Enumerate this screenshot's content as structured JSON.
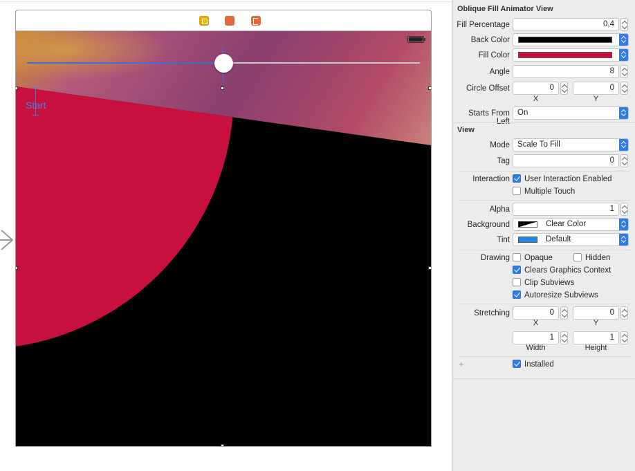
{
  "scene": {
    "slider_value": 0.5,
    "start_label": "Start",
    "fill_color": "#c8103f",
    "back_color": "#000000"
  },
  "inspector": {
    "section1_title": "Oblique Fill Animator View",
    "fill_percentage": {
      "label": "Fill Percentage",
      "value": "0,4"
    },
    "back_color": {
      "label": "Back Color",
      "color": "#000000"
    },
    "fill_color": {
      "label": "Fill Color",
      "color": "#c8103f"
    },
    "angle": {
      "label": "Angle",
      "value": "8"
    },
    "circle_offset": {
      "label": "Circle Offset",
      "x": "0",
      "y": "0",
      "x_label": "X",
      "y_label": "Y"
    },
    "starts_from_left": {
      "label": "Starts From Left",
      "value": "On"
    },
    "section2_title": "View",
    "mode": {
      "label": "Mode",
      "value": "Scale To Fill"
    },
    "tag": {
      "label": "Tag",
      "value": "0"
    },
    "interaction": {
      "label": "Interaction",
      "user_interaction": {
        "label": "User Interaction Enabled",
        "checked": true
      },
      "multiple_touch": {
        "label": "Multiple Touch",
        "checked": false
      }
    },
    "alpha": {
      "label": "Alpha",
      "value": "1"
    },
    "background": {
      "label": "Background",
      "value": "Clear Color"
    },
    "tint": {
      "label": "Tint",
      "value": "Default",
      "color": "#1e88e5"
    },
    "drawing": {
      "label": "Drawing",
      "opaque": {
        "label": "Opaque",
        "checked": false
      },
      "hidden": {
        "label": "Hidden",
        "checked": false
      },
      "clears_graphics": {
        "label": "Clears Graphics Context",
        "checked": true
      },
      "clip_subviews": {
        "label": "Clip Subviews",
        "checked": false
      },
      "autoresize": {
        "label": "Autoresize Subviews",
        "checked": true
      }
    },
    "stretching": {
      "label": "Stretching",
      "x": "0",
      "y": "0",
      "width": "1",
      "height": "1",
      "x_label": "X",
      "y_label": "Y",
      "width_label": "Width",
      "height_label": "Height"
    },
    "installed": {
      "label": "Installed",
      "checked": true
    }
  }
}
